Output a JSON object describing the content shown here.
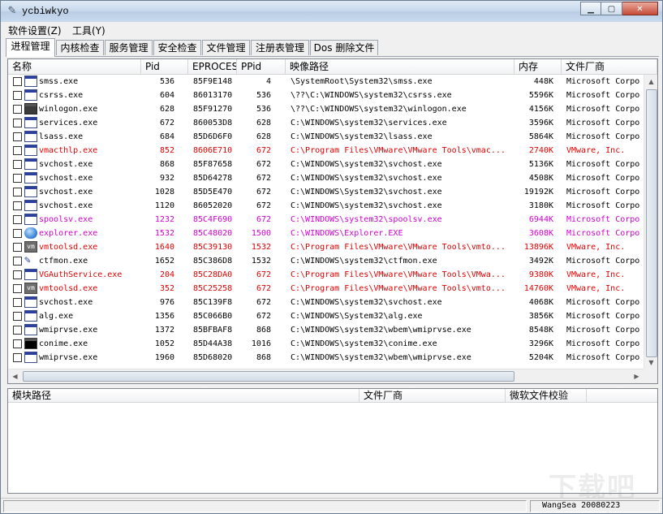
{
  "window": {
    "title": "ycbiwkyo"
  },
  "menu": [
    {
      "label": "软件设置(Z)"
    },
    {
      "label": "工具(Y)"
    }
  ],
  "tabs": [
    {
      "label": "进程管理",
      "active": true
    },
    {
      "label": "内核检查"
    },
    {
      "label": "服务管理"
    },
    {
      "label": "安全检查"
    },
    {
      "label": "文件管理"
    },
    {
      "label": "注册表管理"
    },
    {
      "label": "Dos 删除文件"
    }
  ],
  "process_table": {
    "columns": [
      "名称",
      "Pid",
      "EPROCESS",
      "PPid",
      "映像路径",
      "内存",
      "文件厂商"
    ],
    "rows": [
      {
        "name": "smss.exe",
        "pid": "536",
        "eprocess": "85F9E148",
        "ppid": "4",
        "path": "\\SystemRoot\\System32\\smss.exe",
        "mem": "448K",
        "vendor": "Microsoft Corpo",
        "color": "#000000",
        "icon": "window"
      },
      {
        "name": "csrss.exe",
        "pid": "604",
        "eprocess": "86013170",
        "ppid": "536",
        "path": "\\??\\C:\\WINDOWS\\system32\\csrss.exe",
        "mem": "5596K",
        "vendor": "Microsoft Corpo",
        "color": "#000000",
        "icon": "window"
      },
      {
        "name": "winlogon.exe",
        "pid": "628",
        "eprocess": "85F91270",
        "ppid": "536",
        "path": "\\??\\C:\\WINDOWS\\system32\\winlogon.exe",
        "mem": "4156K",
        "vendor": "Microsoft Corpo",
        "color": "#000000",
        "icon": "dark"
      },
      {
        "name": "services.exe",
        "pid": "672",
        "eprocess": "860053D8",
        "ppid": "628",
        "path": "C:\\WINDOWS\\system32\\services.exe",
        "mem": "3596K",
        "vendor": "Microsoft Corpo",
        "color": "#000000",
        "icon": "window"
      },
      {
        "name": "lsass.exe",
        "pid": "684",
        "eprocess": "85D6D6F0",
        "ppid": "628",
        "path": "C:\\WINDOWS\\system32\\lsass.exe",
        "mem": "5864K",
        "vendor": "Microsoft Corpo",
        "color": "#000000",
        "icon": "window"
      },
      {
        "name": "vmacthlp.exe",
        "pid": "852",
        "eprocess": "8606E710",
        "ppid": "672",
        "path": "C:\\Program Files\\VMware\\VMware Tools\\vmac...",
        "mem": "2740K",
        "vendor": "VMware, Inc.",
        "color": "#e00000",
        "icon": "window"
      },
      {
        "name": "svchost.exe",
        "pid": "868",
        "eprocess": "85F87658",
        "ppid": "672",
        "path": "C:\\WINDOWS\\system32\\svchost.exe",
        "mem": "5136K",
        "vendor": "Microsoft Corpo",
        "color": "#000000",
        "icon": "window"
      },
      {
        "name": "svchost.exe",
        "pid": "932",
        "eprocess": "85D64278",
        "ppid": "672",
        "path": "C:\\WINDOWS\\system32\\svchost.exe",
        "mem": "4508K",
        "vendor": "Microsoft Corpo",
        "color": "#000000",
        "icon": "window"
      },
      {
        "name": "svchost.exe",
        "pid": "1028",
        "eprocess": "85D5E470",
        "ppid": "672",
        "path": "C:\\WINDOWS\\System32\\svchost.exe",
        "mem": "19192K",
        "vendor": "Microsoft Corpo",
        "color": "#000000",
        "icon": "window"
      },
      {
        "name": "svchost.exe",
        "pid": "1120",
        "eprocess": "86052020",
        "ppid": "672",
        "path": "C:\\WINDOWS\\system32\\svchost.exe",
        "mem": "3180K",
        "vendor": "Microsoft Corpo",
        "color": "#000000",
        "icon": "window"
      },
      {
        "name": "spoolsv.exe",
        "pid": "1232",
        "eprocess": "85C4F690",
        "ppid": "672",
        "path": "C:\\WINDOWS\\system32\\spoolsv.exe",
        "mem": "6944K",
        "vendor": "Microsoft Corpo",
        "color": "#d000d0",
        "icon": "window"
      },
      {
        "name": "explorer.exe",
        "pid": "1532",
        "eprocess": "85C48020",
        "ppid": "1500",
        "path": "C:\\WINDOWS\\Explorer.EXE",
        "mem": "3608K",
        "vendor": "Microsoft Corpo",
        "color": "#d000d0",
        "icon": "globe"
      },
      {
        "name": "vmtoolsd.exe",
        "pid": "1640",
        "eprocess": "85C39130",
        "ppid": "1532",
        "path": "C:\\Program Files\\VMware\\VMware Tools\\vmto...",
        "mem": "13896K",
        "vendor": "VMware, Inc.",
        "color": "#e00000",
        "icon": "vm"
      },
      {
        "name": "ctfmon.exe",
        "pid": "1652",
        "eprocess": "85C386D8",
        "ppid": "1532",
        "path": "C:\\WINDOWS\\system32\\ctfmon.exe",
        "mem": "3492K",
        "vendor": "Microsoft Corpo",
        "color": "#000000",
        "icon": "pen"
      },
      {
        "name": "VGAuthService.exe",
        "pid": "204",
        "eprocess": "85C28DA0",
        "ppid": "672",
        "path": "C:\\Program Files\\VMware\\VMware Tools\\VMwa...",
        "mem": "9380K",
        "vendor": "VMware, Inc.",
        "color": "#e00000",
        "icon": "window"
      },
      {
        "name": "vmtoolsd.exe",
        "pid": "352",
        "eprocess": "85C25258",
        "ppid": "672",
        "path": "C:\\Program Files\\VMware\\VMware Tools\\vmto...",
        "mem": "14760K",
        "vendor": "VMware, Inc.",
        "color": "#e00000",
        "icon": "vm"
      },
      {
        "name": "svchost.exe",
        "pid": "976",
        "eprocess": "85C139F8",
        "ppid": "672",
        "path": "C:\\WINDOWS\\system32\\svchost.exe",
        "mem": "4068K",
        "vendor": "Microsoft Corpo",
        "color": "#000000",
        "icon": "window"
      },
      {
        "name": "alg.exe",
        "pid": "1356",
        "eprocess": "85C066B0",
        "ppid": "672",
        "path": "C:\\WINDOWS\\System32\\alg.exe",
        "mem": "3856K",
        "vendor": "Microsoft Corpo",
        "color": "#000000",
        "icon": "window"
      },
      {
        "name": "wmiprvse.exe",
        "pid": "1372",
        "eprocess": "85BFBAF8",
        "ppid": "868",
        "path": "C:\\WINDOWS\\system32\\wbem\\wmiprvse.exe",
        "mem": "8548K",
        "vendor": "Microsoft Corpo",
        "color": "#000000",
        "icon": "window"
      },
      {
        "name": "conime.exe",
        "pid": "1052",
        "eprocess": "85D44A38",
        "ppid": "1016",
        "path": "C:\\WINDOWS\\system32\\conime.exe",
        "mem": "3296K",
        "vendor": "Microsoft Corpo",
        "color": "#000000",
        "icon": "cmd"
      },
      {
        "name": "wmiprvse.exe",
        "pid": "1960",
        "eprocess": "85D68020",
        "ppid": "868",
        "path": "C:\\WINDOWS\\system32\\wbem\\wmiprvse.exe",
        "mem": "5204K",
        "vendor": "Microsoft Corpo",
        "color": "#000000",
        "icon": "window"
      }
    ]
  },
  "module_table": {
    "columns": [
      "模块路径",
      "文件厂商",
      "微软文件校验"
    ]
  },
  "status": {
    "author": "WangSea 20080223"
  },
  "watermark": "下载吧"
}
